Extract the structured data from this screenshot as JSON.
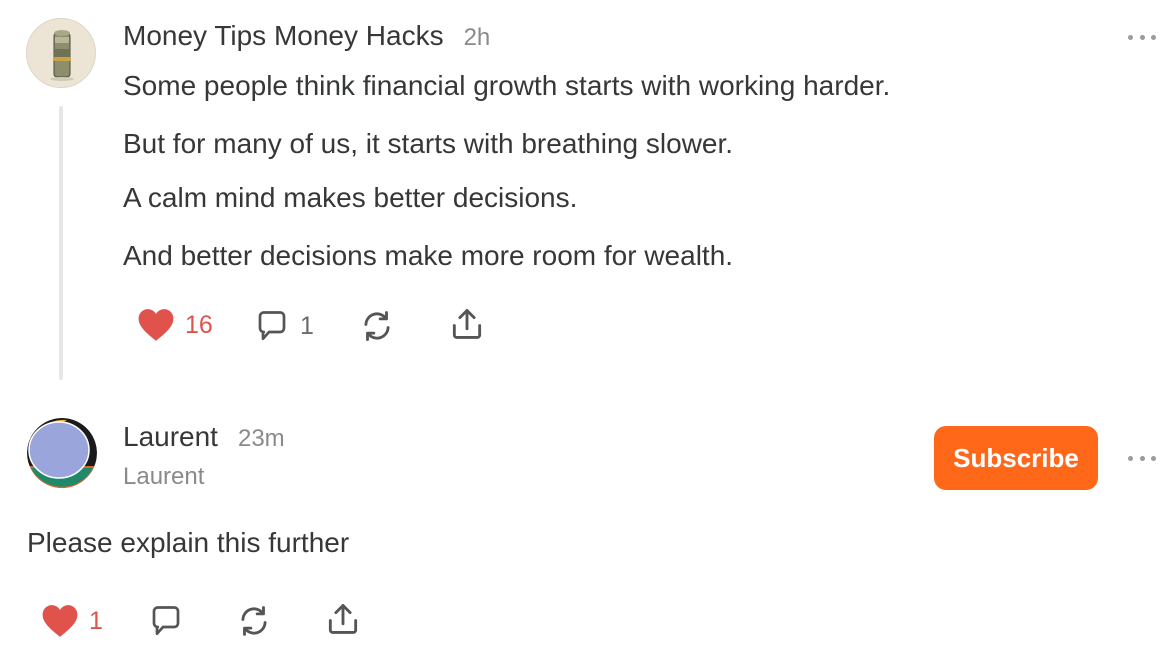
{
  "posts": [
    {
      "author": "Money Tips Money Hacks",
      "time": "2h",
      "avatar_icon": "money-roll",
      "paragraphs": [
        "Some people think financial growth starts with working harder.",
        "But for many of us, it starts with breathing slower.",
        "A calm mind makes better decisions.",
        "And better decisions make more room for wealth."
      ],
      "likes": "16",
      "comments": "1"
    },
    {
      "author": "Laurent",
      "handle": "Laurent",
      "time": "23m",
      "avatar_icon": "abstract-color-avatar",
      "text": "Please explain this further",
      "likes": "1",
      "subscribe_label": "Subscribe"
    }
  ],
  "colors": {
    "like": "#e0534c",
    "subscribe": "#ff6719",
    "thread_line": "#e6e6e6"
  }
}
